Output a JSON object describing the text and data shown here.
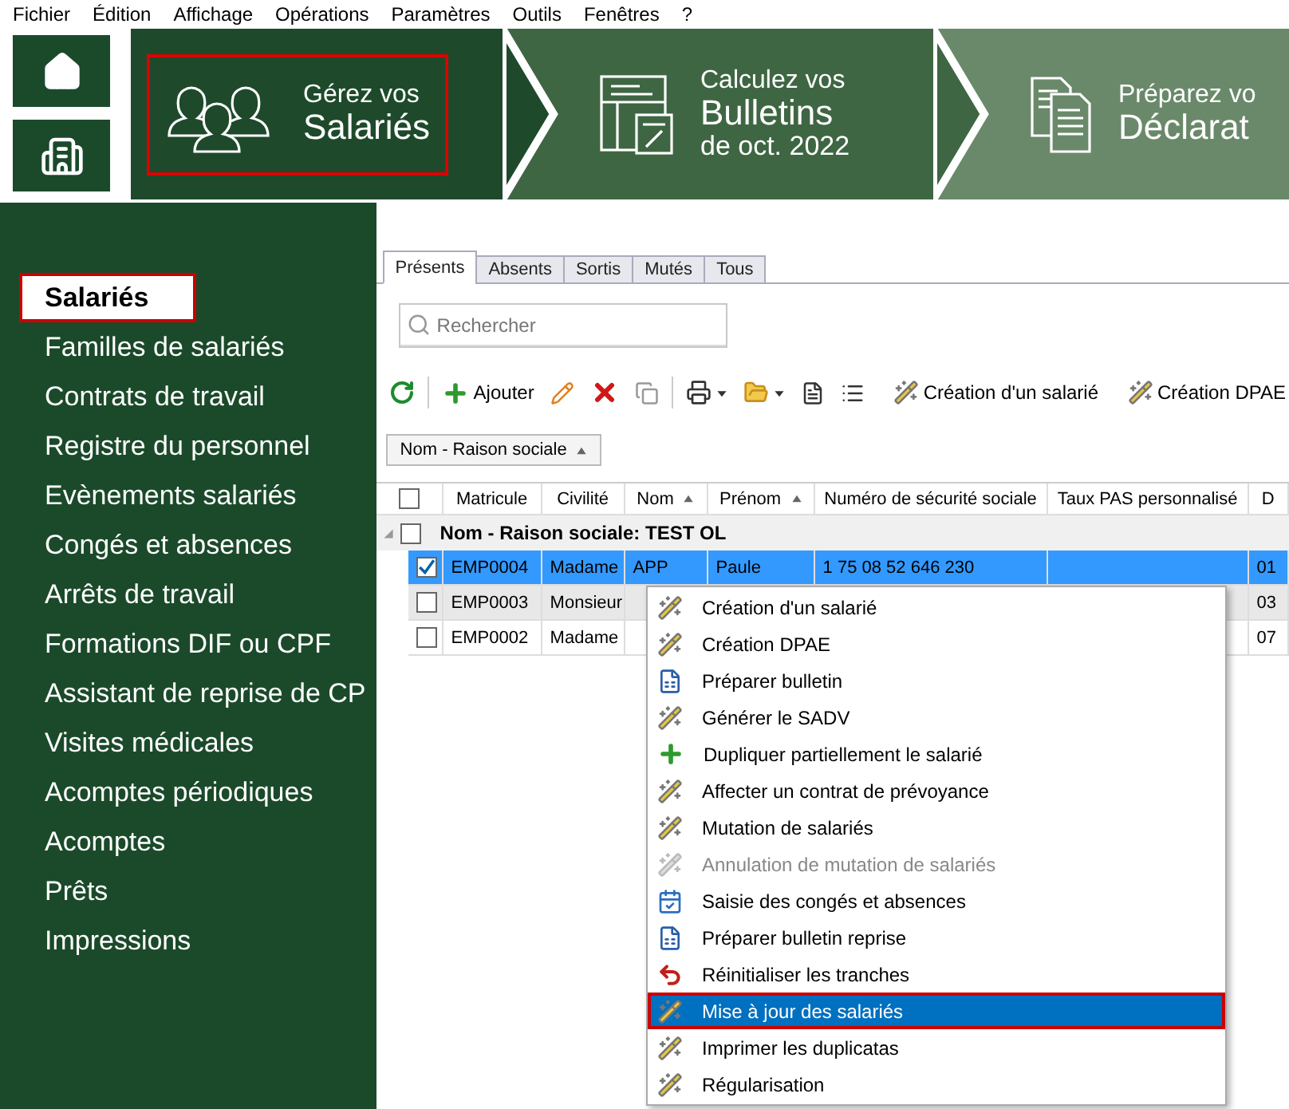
{
  "menu_bar": [
    "Fichier",
    "Édition",
    "Affichage",
    "Opérations",
    "Paramètres",
    "Outils",
    "Fenêtres",
    "?"
  ],
  "steps": [
    {
      "line1": "Gérez vos",
      "line2": "Salariés",
      "selected": true
    },
    {
      "line1": "Calculez vos",
      "line2": "Bulletins",
      "line3": "de oct. 2022",
      "selected": false
    },
    {
      "line1": "Préparez vo",
      "line2": "Déclarat",
      "selected": false
    }
  ],
  "sidebar": {
    "items": [
      {
        "label": "Salariés",
        "selected": true
      },
      {
        "label": "Familles de salariés",
        "selected": false
      },
      {
        "label": "Contrats de travail",
        "selected": false
      },
      {
        "label": "Registre du personnel",
        "selected": false
      },
      {
        "label": "Evènements salariés",
        "selected": false
      },
      {
        "label": "Congés et absences",
        "selected": false
      },
      {
        "label": "Arrêts de travail",
        "selected": false
      },
      {
        "label": "Formations DIF ou CPF",
        "selected": false
      },
      {
        "label": "Assistant de reprise de CP",
        "selected": false
      },
      {
        "label": "Visites médicales",
        "selected": false
      },
      {
        "label": "Acomptes périodiques",
        "selected": false
      },
      {
        "label": "Acomptes",
        "selected": false
      },
      {
        "label": "Prêts",
        "selected": false
      },
      {
        "label": "Impressions",
        "selected": false
      }
    ]
  },
  "tabs": [
    {
      "label": "Présents",
      "selected": true
    },
    {
      "label": "Absents",
      "selected": false
    },
    {
      "label": "Sortis",
      "selected": false
    },
    {
      "label": "Mutés",
      "selected": false
    },
    {
      "label": "Tous",
      "selected": false
    }
  ],
  "search": {
    "placeholder": "Rechercher"
  },
  "toolbar": {
    "add_label": "Ajouter",
    "actions": [
      "Création d'un salarié",
      "Création DPAE"
    ]
  },
  "group_by": {
    "label": "Nom - Raison sociale"
  },
  "table": {
    "header_checked": false,
    "columns": [
      {
        "label": "Matricule",
        "sorted": false
      },
      {
        "label": "Civilité",
        "sorted": false
      },
      {
        "label": "Nom",
        "sorted": true
      },
      {
        "label": "Prénom",
        "sorted": true
      },
      {
        "label": "Numéro de sécurité sociale",
        "sorted": false
      },
      {
        "label": "Taux PAS personnalisé",
        "sorted": false
      },
      {
        "label": "D",
        "sorted": false
      }
    ],
    "group": {
      "label": "Nom - Raison sociale: TEST OL",
      "expanded": true,
      "checked": false
    },
    "rows": [
      {
        "cells": [
          "EMP0004",
          "Madame",
          "APP",
          "Paule",
          "1 75 08 52 646 230",
          "",
          "01"
        ],
        "checked": true,
        "selected": true
      },
      {
        "cells": [
          "EMP0003",
          "Monsieur",
          "",
          "",
          "",
          "",
          "03"
        ],
        "checked": false,
        "selected": false
      },
      {
        "cells": [
          "EMP0002",
          "Madame",
          "",
          "",
          "",
          "",
          "07"
        ],
        "checked": false,
        "selected": false
      }
    ]
  },
  "context_menu": [
    {
      "label": "Création d'un salarié",
      "kind": "wand",
      "disabled": false,
      "selected": false
    },
    {
      "label": "Création DPAE",
      "kind": "wand",
      "disabled": false,
      "selected": false
    },
    {
      "label": "Préparer bulletin",
      "kind": "sheet",
      "disabled": false,
      "selected": false
    },
    {
      "label": "Générer le SADV",
      "kind": "wand",
      "disabled": false,
      "selected": false
    },
    {
      "label": "Dupliquer partiellement le salarié",
      "kind": "plus",
      "disabled": false,
      "selected": false
    },
    {
      "label": "Affecter un contrat de prévoyance",
      "kind": "wand",
      "disabled": false,
      "selected": false
    },
    {
      "label": "Mutation de salariés",
      "kind": "wand",
      "disabled": false,
      "selected": false
    },
    {
      "label": "Annulation de mutation de salariés",
      "kind": "wand",
      "disabled": true,
      "selected": false
    },
    {
      "label": "Saisie des congés et absences",
      "kind": "calendar",
      "disabled": false,
      "selected": false
    },
    {
      "label": "Préparer bulletin reprise",
      "kind": "sheet",
      "disabled": false,
      "selected": false
    },
    {
      "label": "Réinitialiser les tranches",
      "kind": "undo",
      "disabled": false,
      "selected": false
    },
    {
      "label": "Mise à jour des salariés",
      "kind": "wand",
      "disabled": false,
      "selected": true
    },
    {
      "label": "Imprimer les duplicatas",
      "kind": "wand",
      "disabled": false,
      "selected": false
    },
    {
      "label": "Régularisation",
      "kind": "wand",
      "disabled": false,
      "selected": false
    }
  ]
}
